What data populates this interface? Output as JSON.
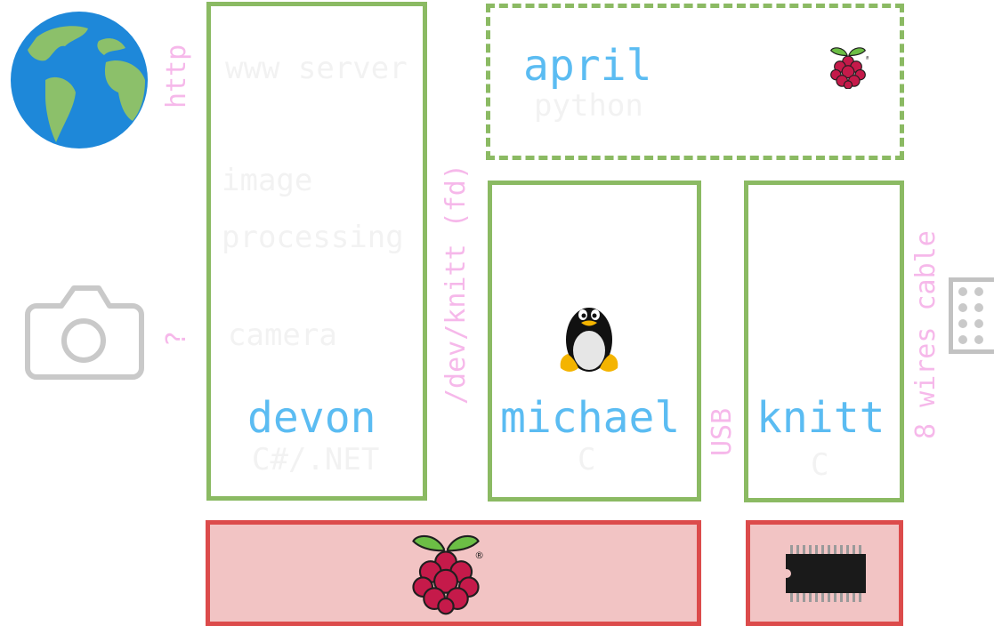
{
  "globe": {
    "icon": "globe-icon"
  },
  "camera": {
    "icon": "camera-icon"
  },
  "connector": {
    "icon": "connector-icon"
  },
  "labels": {
    "http": "http",
    "question": "?",
    "dev_knitt": "/dev/knitt (fd)",
    "usb": "USB",
    "cable": "8 wires cable"
  },
  "devon": {
    "name": "devon",
    "lang": "C#/.NET",
    "roles": [
      "www server",
      "image",
      "processing",
      "camera"
    ]
  },
  "april": {
    "name": "april",
    "lang": "python",
    "icon": "raspberry-pi-icon"
  },
  "michael": {
    "name": "michael",
    "lang": "C",
    "icon": "linux-penguin-icon"
  },
  "knitt": {
    "name": "knitt",
    "lang": "C"
  },
  "hardware": {
    "left_icon": "raspberry-pi-icon",
    "right_icon": "microchip-icon"
  },
  "colors": {
    "box_border": "#8bba63",
    "hw_border": "#dc4b4b",
    "hw_fill": "#f2c4c4",
    "name_text": "#5bbcf2",
    "label_text": "#f6b8ea",
    "faint_text": "#f2f2f2"
  }
}
